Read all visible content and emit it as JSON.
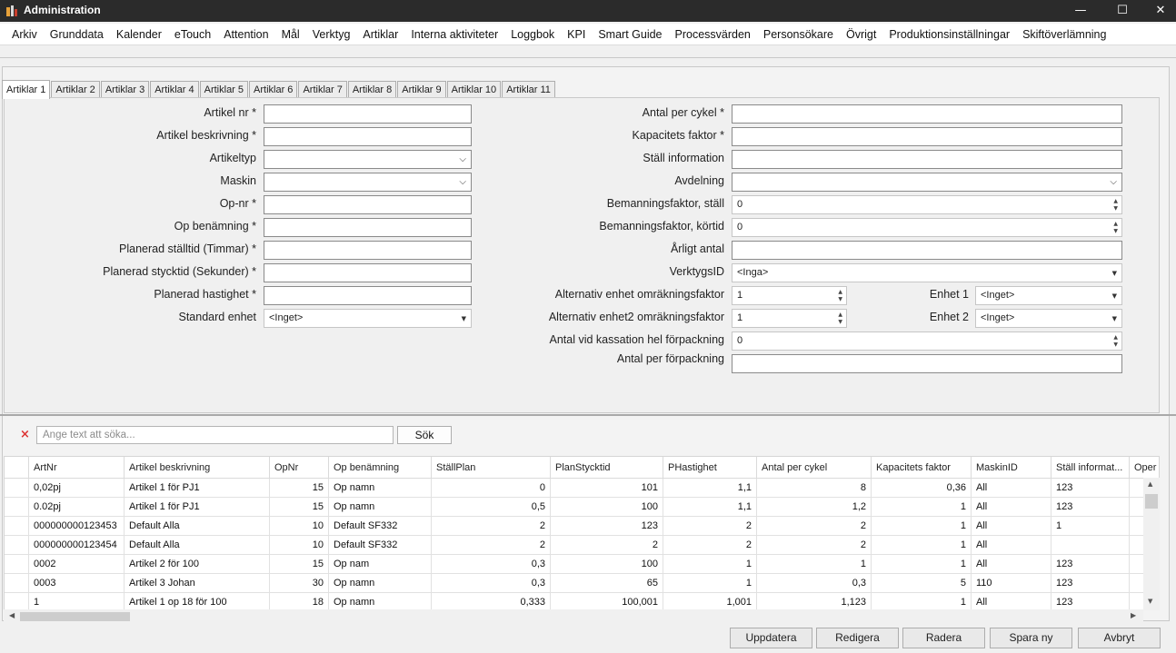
{
  "window": {
    "title": "Administration",
    "minimize": "—",
    "maximize": "☐",
    "close": "✕"
  },
  "menu": [
    "Arkiv",
    "Grunddata",
    "Kalender",
    "eTouch",
    "Attention",
    "Mål",
    "Verktyg",
    "Artiklar",
    "Interna aktiviteter",
    "Loggbok",
    "KPI",
    "Smart Guide",
    "Processvärden",
    "Personsökare",
    "Övrigt",
    "Produktionsinställningar",
    "Skiftöverlämning"
  ],
  "tabs": [
    "Artiklar 1",
    "Artiklar 2",
    "Artiklar 3",
    "Artiklar 4",
    "Artiklar 5",
    "Artiklar 6",
    "Artiklar 7",
    "Artiklar 8",
    "Artiklar 9",
    "Artiklar 10",
    "Artiklar 11"
  ],
  "form": {
    "left": [
      {
        "label": "Artikel nr *",
        "value": ""
      },
      {
        "label": "Artikel beskrivning *",
        "value": ""
      },
      {
        "label": "Artikeltyp",
        "value": ""
      },
      {
        "label": "Maskin",
        "value": ""
      },
      {
        "label": "Op-nr *",
        "value": ""
      },
      {
        "label": "Op benämning *",
        "value": ""
      },
      {
        "label": "Planerad ställtid (Timmar) *",
        "value": ""
      },
      {
        "label": "Planerad stycktid (Sekunder) *",
        "value": ""
      },
      {
        "label": "Planerad hastighet *",
        "value": ""
      },
      {
        "label": "Standard enhet",
        "value": "<Inget>"
      }
    ],
    "right": [
      {
        "label": "Antal per cykel *",
        "value": ""
      },
      {
        "label": "Kapacitets faktor *",
        "value": ""
      },
      {
        "label": "Ställ information",
        "value": ""
      },
      {
        "label": "Avdelning",
        "value": ""
      },
      {
        "label": "Bemanningsfaktor, ställ",
        "value": "0"
      },
      {
        "label": "Bemanningsfaktor, körtid",
        "value": "0"
      },
      {
        "label": "Årligt antal",
        "value": ""
      },
      {
        "label": "VerktygsID",
        "value": "<Inga>"
      },
      {
        "label": "Alternativ enhet omräkningsfaktor",
        "value": "1"
      },
      {
        "label": "Alternativ enhet2 omräkningsfaktor",
        "value": "1"
      },
      {
        "label": "Antal vid kassation hel förpackning",
        "value": "0"
      },
      {
        "label": "Antal per förpackning",
        "value": ""
      }
    ],
    "unit1": {
      "label": "Enhet 1",
      "value": "<Inget>"
    },
    "unit2": {
      "label": "Enhet 2",
      "value": "<Inget>"
    }
  },
  "search": {
    "placeholder": "Ange text att söka...",
    "button": "Sök",
    "clear": "×"
  },
  "grid": {
    "columns": [
      "ArtNr",
      "Artikel beskrivning",
      "OpNr",
      "Op benämning",
      "StällPlan",
      "PlanStycktid",
      "PHastighet",
      "Antal per cykel",
      "Kapacitets faktor",
      "MaskinID",
      "Ställ informat...",
      "Oper"
    ],
    "rows": [
      [
        "0,02pj",
        "Artikel 1  för PJ1",
        "15",
        "Op namn",
        "0",
        "101",
        "1,1",
        "8",
        "0,36",
        "All",
        "123",
        ""
      ],
      [
        "0.02pj",
        "Artikel 1  för PJ1",
        "15",
        "Op namn",
        "0,5",
        "100",
        "1,1",
        "1,2",
        "1",
        "All",
        "123",
        ""
      ],
      [
        "000000000123453",
        "Default Alla",
        "10",
        "Default SF332",
        "2",
        "123",
        "2",
        "2",
        "1",
        "All",
        "1",
        ""
      ],
      [
        "000000000123454",
        "Default Alla",
        "10",
        "Default SF332",
        "2",
        "2",
        "2",
        "2",
        "1",
        "All",
        "",
        ""
      ],
      [
        "0002",
        "Artikel 2  för 100",
        "15",
        "Op nam",
        "0,3",
        "100",
        "1",
        "1",
        "1",
        "All",
        "123",
        ""
      ],
      [
        "0003",
        "Artikel 3 Johan",
        "30",
        "Op namn",
        "0,3",
        "65",
        "1",
        "0,3",
        "5",
        "110",
        "123",
        ""
      ],
      [
        "1",
        "Artikel 1 op 18 för 100",
        "18",
        "Op namn",
        "0,333",
        "100,001",
        "1,001",
        "1,123",
        "1",
        "All",
        "123",
        ""
      ]
    ]
  },
  "buttons": [
    "Uppdatera",
    "Redigera",
    "Radera",
    "Spara ny",
    "Avbryt"
  ]
}
